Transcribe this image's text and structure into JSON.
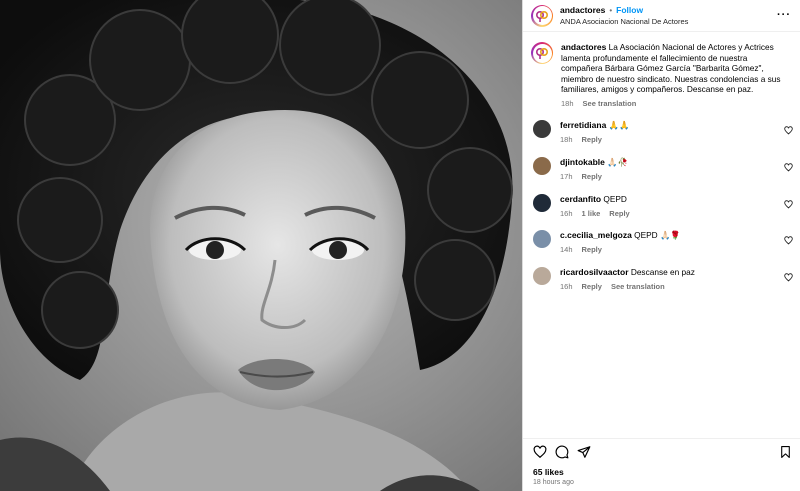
{
  "post": {
    "username": "andactores",
    "separator": "•",
    "follow_label": "Follow",
    "subtitle": "ANDA Asociacion Nacional De Actores",
    "more_icon": "more-horizontal-icon"
  },
  "caption": {
    "username": "andactores",
    "text": "La Asociación Nacional de Actores y Actrices lamenta profundamente el fallecimiento de nuestra compañera Bárbara Gómez García \"Barbarita Gómez\", miembro de nuestro sindicato. Nuestras condolencias a sus familiares, amigos y compañeros. Descanse en paz.",
    "time": "18h",
    "see_translation": "See translation"
  },
  "comments": [
    {
      "username": "ferretidiana",
      "text": "🙏🙏",
      "time": "18h",
      "likes": "",
      "reply": "Reply",
      "see_translation": "",
      "avatar_color": "#3a3a3a"
    },
    {
      "username": "djintokable",
      "text": "🙏🏻🥀",
      "time": "17h",
      "likes": "",
      "reply": "Reply",
      "see_translation": "",
      "avatar_color": "#8a6a4a"
    },
    {
      "username": "cerdanfito",
      "text": "QEPD",
      "time": "16h",
      "likes": "1 like",
      "reply": "Reply",
      "see_translation": "",
      "avatar_color": "#1f2a38"
    },
    {
      "username": "c.cecilia_melgoza",
      "text": "QEPD 🙏🏻🌹",
      "time": "14h",
      "likes": "",
      "reply": "Reply",
      "see_translation": "",
      "avatar_color": "#7a8fa8"
    },
    {
      "username": "ricardosilvaactor",
      "text": "Descanse en paz",
      "time": "16h",
      "likes": "",
      "reply": "Reply",
      "see_translation": "See translation",
      "avatar_color": "#b9a99a"
    }
  ],
  "actions": {
    "like_icon": "heart-icon",
    "comment_icon": "comment-icon",
    "share_icon": "send-icon",
    "save_icon": "bookmark-icon"
  },
  "likes": "65 likes",
  "timestamp": "18 hours ago",
  "colors": {
    "accent": "#0095f6",
    "muted": "#737373",
    "border": "#dbdbdb"
  }
}
